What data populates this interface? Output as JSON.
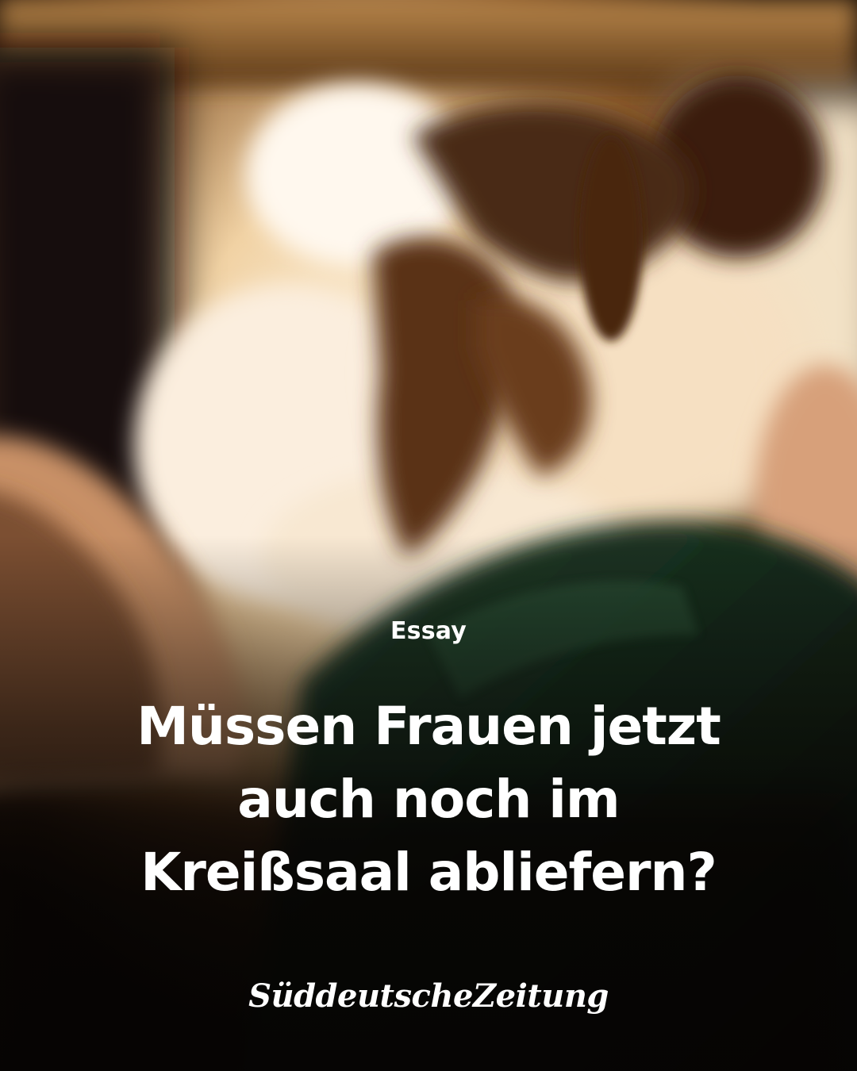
{
  "article": {
    "kicker": "Essay",
    "headline_lines": [
      "Müssen Frauen jetzt",
      "auch noch im",
      "Kreißsaal abliefern?"
    ]
  },
  "brand": {
    "name": "SüddeutscheZeitung"
  },
  "colors": {
    "text": "#ffffff",
    "background_dark": "#0d0906",
    "warm_light": "#f4dcb4",
    "sheet_green": "#1f3a28"
  }
}
